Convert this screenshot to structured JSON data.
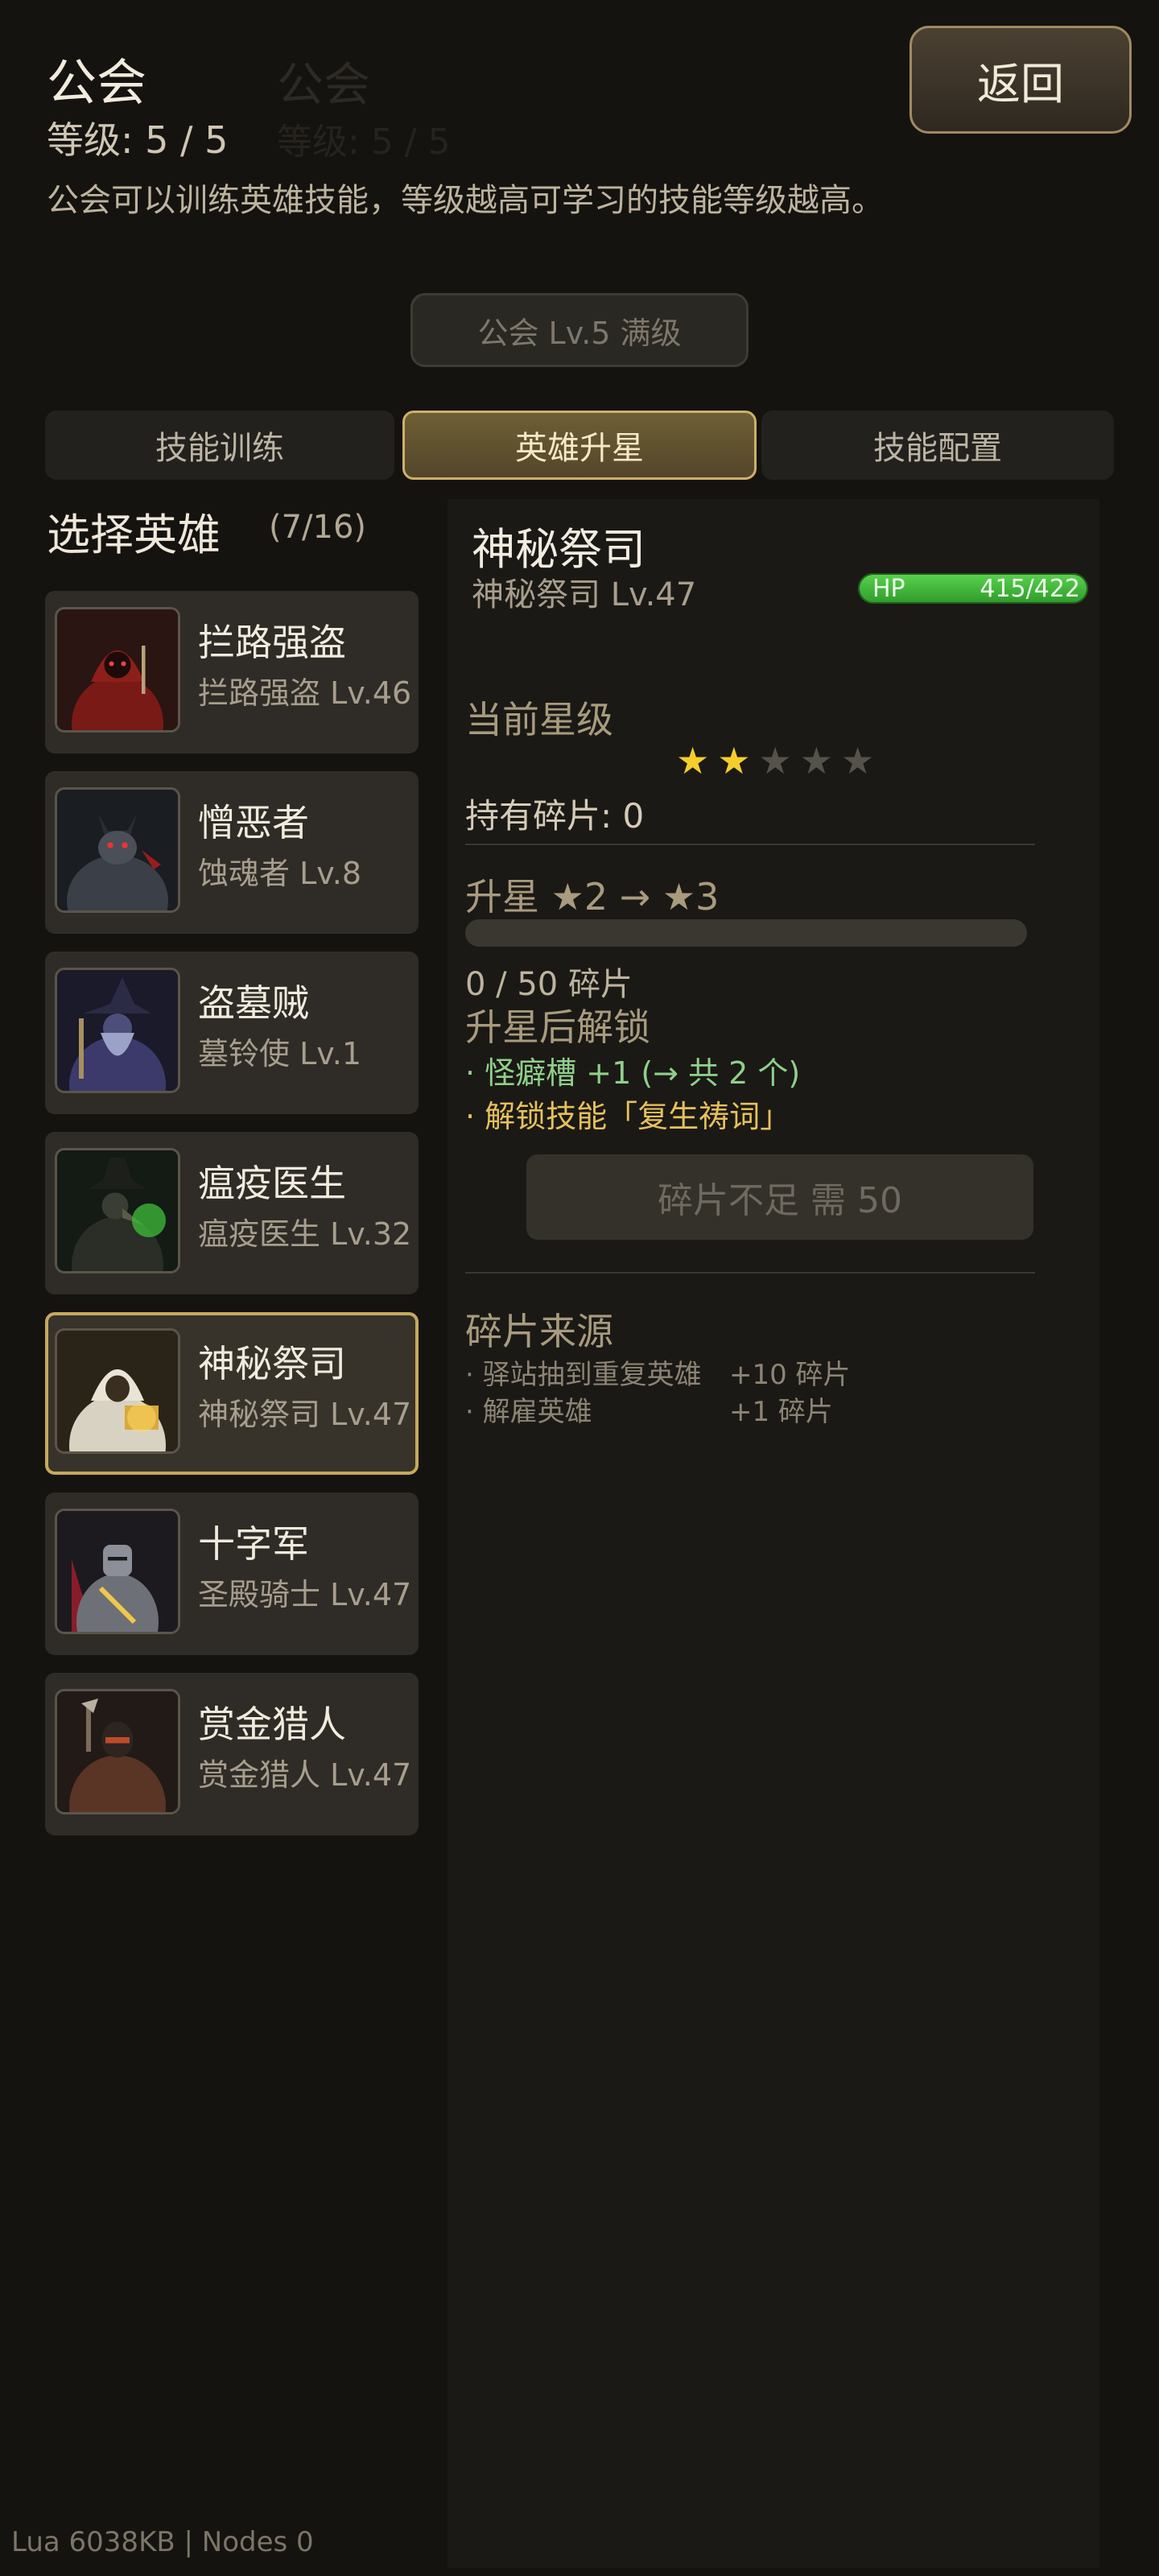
{
  "header": {
    "title": "公会",
    "level": "等级: 5 / 5",
    "description": "公会可以训练英雄技能，等级越高可学习的技能等级越高。",
    "back_label": "返回",
    "guild_badge": "公会 Lv.5 满级"
  },
  "tabs": [
    {
      "label": "技能训练",
      "active": false
    },
    {
      "label": "英雄升星",
      "active": true
    },
    {
      "label": "技能配置",
      "active": false
    }
  ],
  "hero_list": {
    "title": "选择英雄",
    "count": "(7/16)",
    "heroes": [
      {
        "name": "拦路强盗",
        "sub": "拦路强盗 Lv.46",
        "icon": "bandit-portrait",
        "selected": false
      },
      {
        "name": "憎恶者",
        "sub": "蚀魂者 Lv.8",
        "icon": "abomination-portrait",
        "selected": false
      },
      {
        "name": "盗墓贼",
        "sub": "墓铃使 Lv.1",
        "icon": "grave-robber-portrait",
        "selected": false
      },
      {
        "name": "瘟疫医生",
        "sub": "瘟疫医生 Lv.32",
        "icon": "plague-doctor-portrait",
        "selected": false
      },
      {
        "name": "神秘祭司",
        "sub": "神秘祭司 Lv.47",
        "icon": "occultist-portrait",
        "selected": true
      },
      {
        "name": "十字军",
        "sub": "圣殿骑士 Lv.47",
        "icon": "crusader-portrait",
        "selected": false
      },
      {
        "name": "赏金猎人",
        "sub": "赏金猎人 Lv.47",
        "icon": "bounty-hunter-portrait",
        "selected": false
      }
    ]
  },
  "detail": {
    "name": "神秘祭司",
    "level": "神秘祭司 Lv.47",
    "hp_label": "HP",
    "hp_text": "415/422",
    "hp_fraction": 0.983,
    "star_label": "当前星级",
    "stars_filled": 2,
    "stars_total": 5,
    "fragments": "持有碎片: 0",
    "upgrade_title": "升星 ★2 → ★3",
    "progress_fraction": 0,
    "progress_text": "0 / 50 碎片",
    "unlock_title": "升星后解锁",
    "unlock_items": [
      "· 怪癖槽 +1 (→ 共 2 个)",
      "· 解锁技能「复生祷词」"
    ],
    "upgrade_button": "碎片不足  需 50",
    "source_title": "碎片来源",
    "sources": [
      {
        "label": "· 驿站抽到重复英雄",
        "amount": "+10 碎片"
      },
      {
        "label": "· 解雇英雄",
        "amount": "+1 碎片"
      }
    ]
  },
  "footer": "Lua 6038KB | Nodes 0",
  "colors": {
    "background": "#15130f",
    "accent_gold": "#cdb06a",
    "hp_green": "#3fb838",
    "star_gold": "#f4cf2b",
    "unlock_green": "#8fd08a",
    "unlock_gold": "#e6c05c"
  }
}
